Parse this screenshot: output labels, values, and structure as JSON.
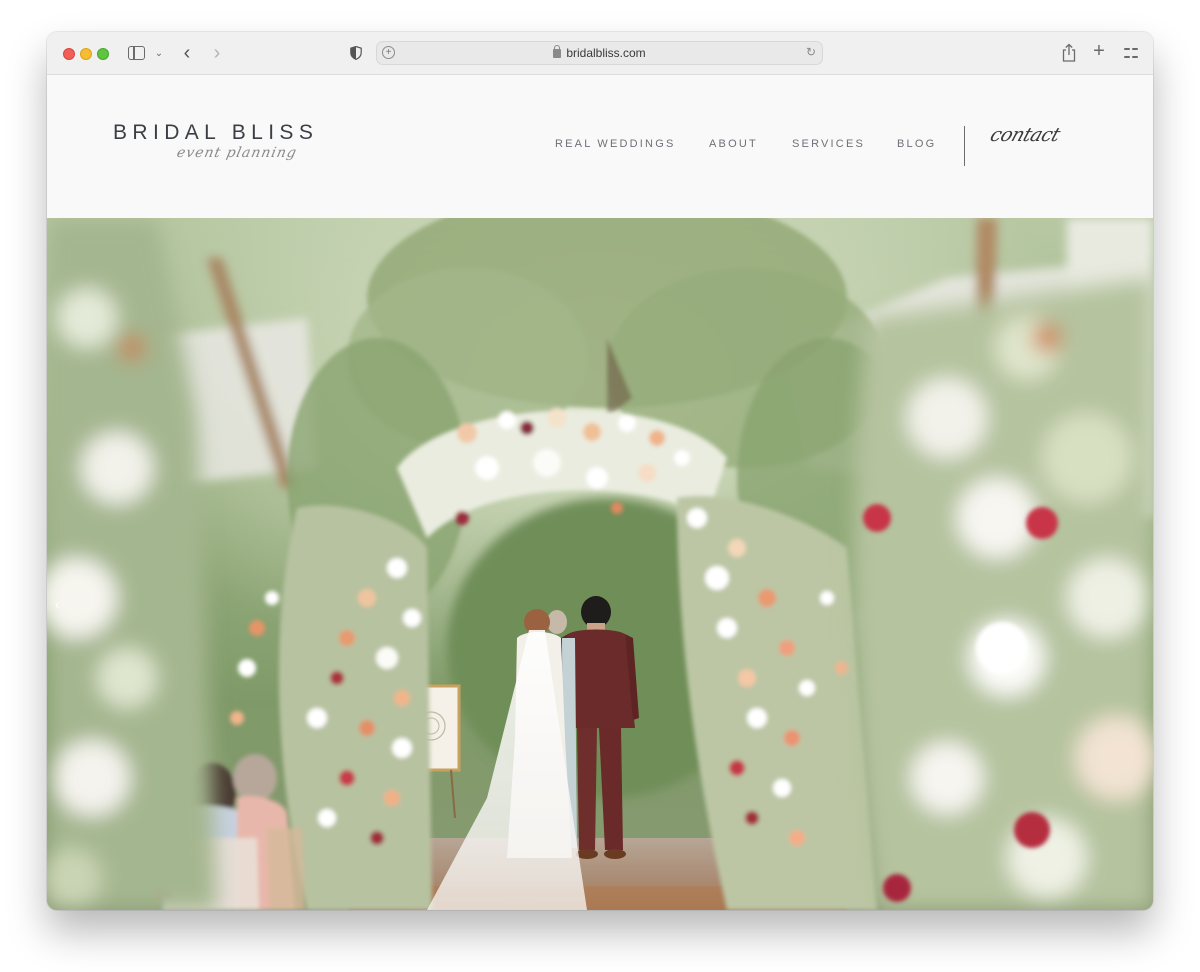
{
  "browser": {
    "url": "bridalbliss.com",
    "icons": {
      "close": "traffic-light-red",
      "minimize": "traffic-light-yellow",
      "maximize": "traffic-light-green",
      "sidebar": "sidebar-icon",
      "sidebar_menu": "chevron-down-icon",
      "back": "chevron-left-icon",
      "forward": "chevron-right-icon",
      "privacy": "shield-icon",
      "page_settings": "plus-circle-icon",
      "lock": "lock-icon",
      "reload": "reload-icon",
      "share": "share-icon",
      "new_tab": "plus-icon",
      "tab_overview": "grid-icon"
    },
    "glyphs": {
      "chevron_down": "⌄",
      "back": "‹",
      "forward": "›",
      "plus_small": "+",
      "reload": "↻",
      "new_tab": "+"
    }
  },
  "site": {
    "logo": {
      "title": "BRIDAL BLISS",
      "tagline": "event planning"
    },
    "nav": [
      {
        "label": "REAL WEDDINGS"
      },
      {
        "label": "ABOUT"
      },
      {
        "label": "SERVICES"
      },
      {
        "label": "BLOG"
      }
    ],
    "contact_label": "contact",
    "hero": {
      "image_description": "Bride and groom standing under a floral arch at an outdoor garden wedding ceremony, guests seated in foreground",
      "prev_arrow": "‹"
    }
  },
  "colors": {
    "header_bg": "#f9f9f9",
    "logo_text": "#3b3f45",
    "nav_text": "#6d7177",
    "groom_suit": "#6e2d2a",
    "foliage": "#8fa874",
    "rose_accent": "#c8344a",
    "peach_accent": "#e8a27a"
  }
}
